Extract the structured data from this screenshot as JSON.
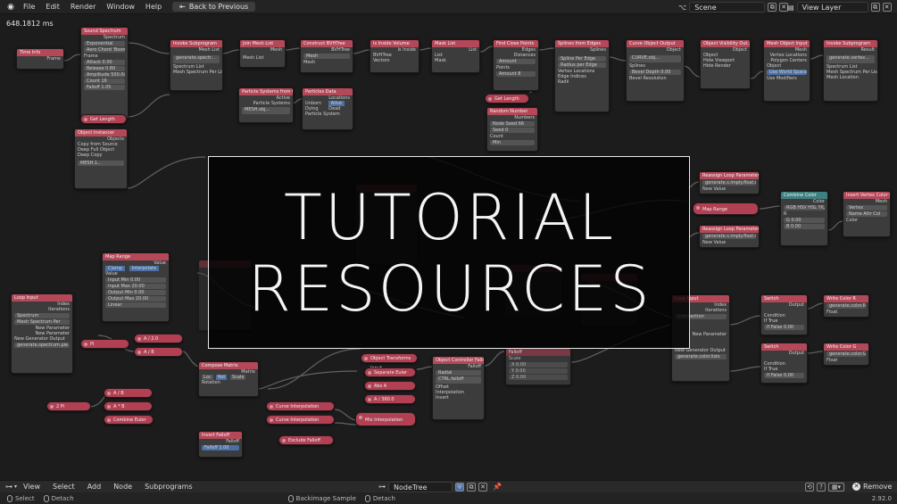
{
  "topbar": {
    "menu": [
      "File",
      "Edit",
      "Render",
      "Window",
      "Help"
    ],
    "back_button": "Back to Previous",
    "scene": "Scene",
    "view_layer": "View Layer"
  },
  "editor": {
    "timing": "648.1812 ms"
  },
  "overlay": {
    "line1": "TUTORIAL",
    "line2": "RESOURCES"
  },
  "nodes": {
    "time_info": {
      "title": "Time Info",
      "row": "Frame"
    },
    "sound_spectrum": {
      "title": "Sound Spectrum",
      "rows": [
        "Spectrum",
        "Exponential",
        "Aero Chord 'Boom ...",
        "Frame",
        "Attack 0.00",
        "Release 0.80",
        "Amplitude 500.00",
        "Count 16",
        "Falloff 1.05"
      ]
    },
    "get_length": {
      "title": "Get Length"
    },
    "object_instancer": {
      "title": "Object Instancer",
      "rows": [
        "Objects",
        "Copy from Source",
        "Deep Full Object",
        "Deep Copy",
        "MESH.1..."
      ]
    },
    "invoke_subprogram1": {
      "title": "Invoke Subprogram",
      "rows": [
        "Mesh List",
        "generate.spectr...",
        "Spectrum List",
        "Mesh Spectrum Per List"
      ]
    },
    "join_mesh_list": {
      "title": "Join Mesh List",
      "rows": [
        "Mesh",
        "Mesh List"
      ]
    },
    "construct_bmtree": {
      "title": "Construct BVHTree",
      "rows": [
        "BVHTree",
        "Source",
        "Mesh",
        "Mesh"
      ]
    },
    "is_inside_volume": {
      "title": "Is Inside Volume",
      "rows": [
        "Is Inside",
        "BVHTree",
        "Vectors"
      ]
    },
    "mask_list": {
      "title": "Mask List",
      "rows": [
        "List",
        "List",
        "Mask"
      ]
    },
    "find_close_points": {
      "title": "Find Close Points",
      "rows": [
        "Edges",
        "Distances",
        "Mode",
        "Amount",
        "Points",
        "Amount 8"
      ]
    },
    "splines_from_edges": {
      "title": "Splines from Edges",
      "rows": [
        "Splines",
        "Spline Per Edge",
        "Radius per Edge",
        "Vertex Locations",
        "Edge Indices",
        "Radii"
      ]
    },
    "curve_object_output": {
      "title": "Curve Object Output",
      "rows": [
        "Object",
        "CURVE.obj...",
        "Splines",
        "Bevel Depth 0.00",
        "Bevel Resolution"
      ]
    },
    "object_visibility": {
      "title": "Object Visibility Out...",
      "rows": [
        "Object",
        "Object",
        "Hide Viewport",
        "Hide Render"
      ]
    },
    "mesh_object_input": {
      "title": "Mesh Object Input",
      "rows": [
        "Mesh",
        "Vertex Locations",
        "Polygon Centers",
        "Object",
        "Use World Space",
        "Use Modifiers"
      ]
    },
    "invoke_subprogram2": {
      "title": "Invoke Subprogram",
      "rows": [
        "Result",
        "generate.vertex...",
        "Spectrum List",
        "Mesh Spectrum Per List",
        "Mesh Location"
      ]
    },
    "particle_systems": {
      "title": "Particle Systems from O...",
      "rows": [
        "Active",
        "Particle Systems",
        "MESH.obj..."
      ]
    },
    "particles_data": {
      "title": "Particles Data",
      "rows": [
        "Locations",
        "Unborn",
        "Alive",
        "Dying",
        "Dead",
        "Particle System"
      ]
    },
    "get_length2": {
      "title": "Get Length"
    },
    "random_number": {
      "title": "Random Number",
      "rows": [
        "Numbers",
        "Node Seed 66",
        "Seed 0",
        "Count",
        "Min"
      ]
    },
    "reassign_param1": {
      "title": "Reassign Loop Parameter",
      "rows": [
        "generate.s.imply.float.B",
        "New Value"
      ]
    },
    "map_range_pill": {
      "title": "Map Range"
    },
    "reassign_param2": {
      "title": "Reassign Loop Parameter",
      "rows": [
        "generate.s.imply.float.C",
        "New Value"
      ]
    },
    "combine_color": {
      "title": "Combine Color",
      "rows": [
        "Color",
        "RGB HSV HSL YIQ",
        "R",
        "G 0.00",
        "B 0.00"
      ]
    },
    "insert_vertex_color": {
      "title": "Insert Vertex Color L...",
      "rows": [
        "Mesh",
        "Vertex",
        "Name Attr Col",
        "Color"
      ]
    },
    "map_range": {
      "title": "Map Range",
      "rows": [
        "Value",
        "Clamp",
        "Interpolate",
        "Value",
        "Input Min 0.00",
        "Input Max 20.00",
        "Output Min 0.00",
        "Output Max 20.00",
        "Linear"
      ]
    },
    "loop_input": {
      "title": "Loop Input",
      "rows": [
        "Index",
        "Iterations",
        "Spectrum",
        "Mesh Spectrum Per",
        "New Parameter",
        "New Parameter",
        "New Generator Output",
        "generate.spectrum.pie"
      ]
    },
    "pi_pill": {
      "title": "Pi"
    },
    "a12_pill": {
      "title": "A / 2.0"
    },
    "a_b_pill1": {
      "title": "A / B"
    },
    "compose_matrix": {
      "title": "Compose Matrix",
      "rows": [
        "Matrix",
        "Loc",
        "Rot",
        "Scale",
        "Rotation"
      ]
    },
    "a_b_pill2": {
      "title": "A / B"
    },
    "a_b_pill3": {
      "title": "A * B"
    },
    "combine_euler": {
      "title": "Combine Euler"
    },
    "two_pi": {
      "title": "2 Pi"
    },
    "invert_falloff": {
      "title": "Invert Falloff",
      "rows": [
        "Falloff",
        "Falloff 1.00"
      ]
    },
    "curve_interp1": {
      "title": "Curve Interpolation"
    },
    "curve_interp2": {
      "title": "Curve Interpolation"
    },
    "mix_interp": {
      "title": "Mix Interpolation"
    },
    "exclude_falloff": {
      "title": "Exclude Falloff"
    },
    "object_transforms": {
      "title": "Object Transforms Input"
    },
    "separate_euler": {
      "title": "Separate Euler"
    },
    "abs_pill": {
      "title": "Abs A"
    },
    "a_360": {
      "title": "A / 360.0"
    },
    "object_controller": {
      "title": "Object Controller Falloff",
      "rows": [
        "Falloff",
        "Radial",
        "CTRL.falloff",
        "Offset",
        "Interpolation",
        "Invert"
      ]
    },
    "falloff_node": {
      "title": "Falloff",
      "rows": [
        "Falloff",
        "Scale",
        "X 0.00",
        "Y 0.00",
        "Z 0.00"
      ]
    },
    "loop_input2": {
      "title": "Loop Input",
      "rows": [
        "Index",
        "Iterations",
        "Intersection",
        "New Parameter",
        "New Generator Output",
        "generate.color.lists"
      ]
    },
    "switch1": {
      "title": "Switch",
      "rows": [
        "Output",
        "Condition",
        "If True",
        "If False 0.00"
      ]
    },
    "write_color1": {
      "title": "Write Color R",
      "rows": [
        "generate.color.R",
        "Float"
      ]
    },
    "switch2": {
      "title": "Switch",
      "rows": [
        "Output",
        "Condition",
        "If True",
        "If False 0.00"
      ]
    },
    "write_color2": {
      "title": "Write Color G",
      "rows": [
        "generate.color.G",
        "Float"
      ]
    }
  },
  "node_header": {
    "menu": [
      "View",
      "Select",
      "Add",
      "Node",
      "Subprograms"
    ],
    "tree_name": "NodeTree",
    "remove_label": "Remove"
  },
  "statusbar": {
    "items": [
      "Select",
      "Detach",
      "Backimage Sample",
      "Detach"
    ],
    "version": "2.92.0"
  },
  "colors": {
    "node_header_red": "#b54858",
    "node_header_teal": "#3e7f80",
    "node_body": "#3c3c3c",
    "editor_bg": "#1c1c1c"
  }
}
